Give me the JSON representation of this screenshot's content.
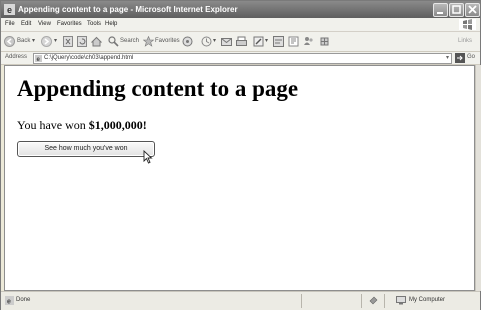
{
  "window": {
    "title": "Appending content to a page - Microsoft Internet Explorer"
  },
  "menu": {
    "file": "File",
    "edit": "Edit",
    "view": "View",
    "favorites": "Favorites",
    "tools": "Tools",
    "help": "Help"
  },
  "toolbar": {
    "back": "Back",
    "search": "Search",
    "favorites": "Favorites",
    "links": "Links"
  },
  "address": {
    "label": "Address",
    "url": "C:\\jQuery\\code\\ch03\\append.html",
    "go": "Go"
  },
  "page": {
    "heading": "Appending content to a page",
    "message_prefix": "You have won ",
    "message_amount": "$1,000,000!",
    "button_label": "See how much you've won"
  },
  "status": {
    "text": "Done",
    "zone": "My Computer"
  }
}
